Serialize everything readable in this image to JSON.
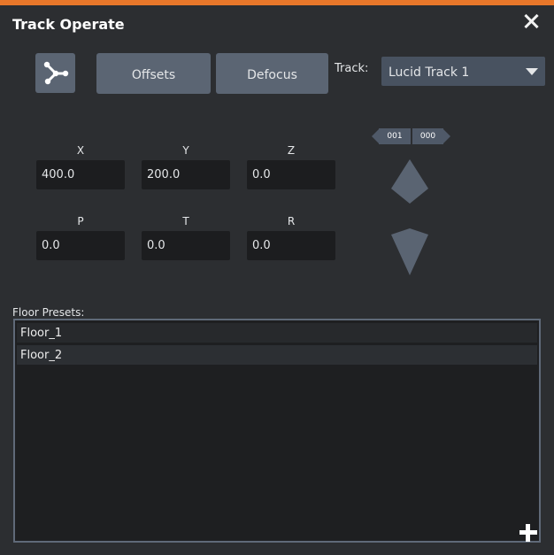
{
  "window": {
    "title": "Track Operate",
    "accent_color": "#e8772a"
  },
  "toolbar": {
    "tool_icon": "track-tool-icon",
    "offsets_label": "Offsets",
    "defocus_label": "Defocus",
    "track_label": "Track:",
    "track_selected": "Lucid Track 1"
  },
  "fields": {
    "x": {
      "label": "X",
      "value": "400.0"
    },
    "y": {
      "label": "Y",
      "value": "200.0"
    },
    "z": {
      "label": "Z",
      "value": "0.0"
    },
    "p": {
      "label": "P",
      "value": "0.0"
    },
    "t": {
      "label": "T",
      "value": "0.0"
    },
    "r": {
      "label": "R",
      "value": "0.0"
    }
  },
  "counter": {
    "left": "001",
    "right": "000"
  },
  "presets": {
    "label": "Floor Presets:",
    "items": [
      "Floor_1",
      "Floor_2"
    ]
  }
}
